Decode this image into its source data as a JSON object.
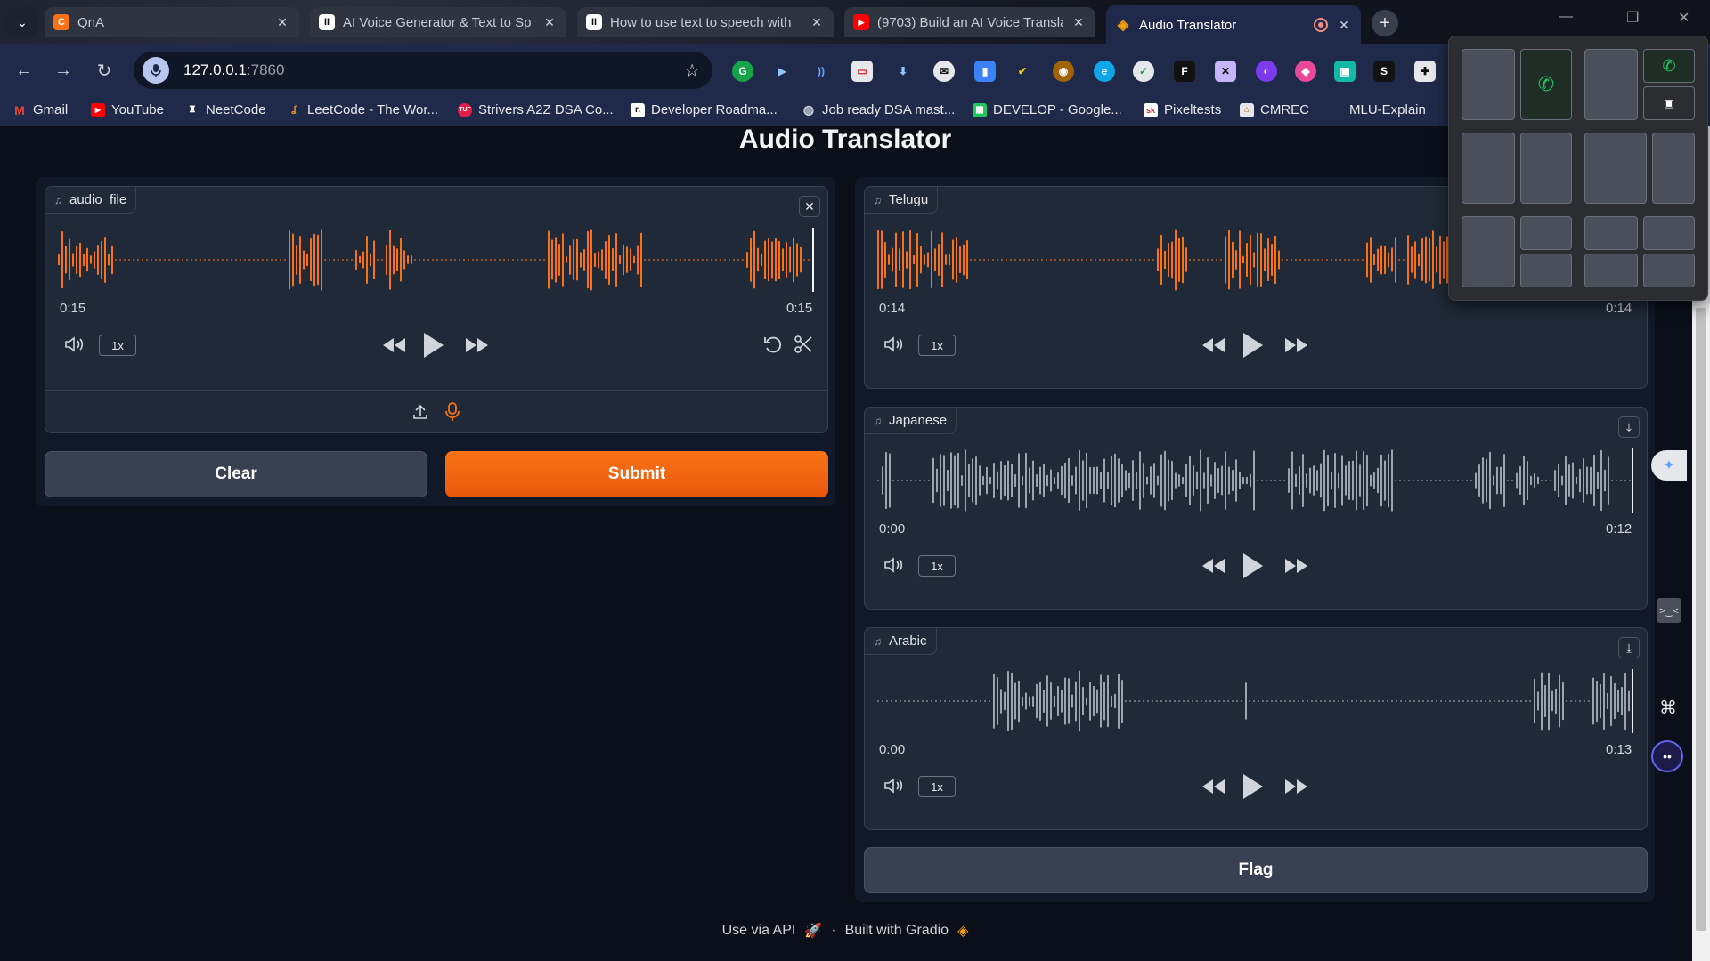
{
  "browser": {
    "tabs": [
      {
        "title": "QnA",
        "favicon_color": "#f97316",
        "favicon_glyph": "C"
      },
      {
        "title": "AI Voice Generator & Text to Sp",
        "favicon_color": "#ffffff",
        "favicon_glyph": "II"
      },
      {
        "title": "How to use text to speech with",
        "favicon_color": "#ffffff",
        "favicon_glyph": "II"
      },
      {
        "title": "(9703) Build an AI Voice Transla",
        "favicon_color": "#ff0000",
        "favicon_glyph": "▶"
      },
      {
        "title": "Audio Translator",
        "favicon_color": "#f59e0b",
        "favicon_glyph": "◈",
        "active": true
      }
    ],
    "url_host": "127.0.0.1",
    "url_port": ":7860",
    "bookmarks": [
      {
        "label": "Gmail",
        "icon": "gmail-icon",
        "color": "#ea4335"
      },
      {
        "label": "YouTube",
        "icon": "youtube-icon",
        "color": "#ff0000"
      },
      {
        "label": "NeetCode",
        "icon": "neetcode-icon",
        "color": "#ffffff"
      },
      {
        "label": "LeetCode - The Wor...",
        "icon": "leetcode-icon",
        "color": "#f89f1b"
      },
      {
        "label": "Strivers A2Z DSA Co...",
        "icon": "tuf-icon",
        "color": "#e11d48"
      },
      {
        "label": "Developer Roadma...",
        "icon": "roadmap-icon",
        "color": "#ffffff"
      },
      {
        "label": "Job ready DSA mast...",
        "icon": "globe-icon",
        "color": "#9ca3af"
      },
      {
        "label": "DEVELOP - Google...",
        "icon": "sheets-icon",
        "color": "#22c55e"
      },
      {
        "label": "Pixeltests",
        "icon": "pixeltests-icon",
        "color": "#dc2626"
      },
      {
        "label": "CMREC",
        "icon": "cmrec-icon",
        "color": "#a16207"
      },
      {
        "label": "MLU-Explain",
        "icon": "mlu-icon",
        "color": "#1f2a4a"
      }
    ]
  },
  "app": {
    "title": "Audio Translator",
    "input": {
      "label": "audio_file",
      "time_current": "0:15",
      "time_total": "0:15",
      "speed": "1x",
      "wave_color": "#f97316"
    },
    "outputs": [
      {
        "label": "Telugu",
        "time_current": "0:14",
        "time_total": "0:14",
        "speed": "1x",
        "wave_color": "#f97316"
      },
      {
        "label": "Japanese",
        "time_current": "0:00",
        "time_total": "0:12",
        "speed": "1x",
        "wave_color": "#9ca3af"
      },
      {
        "label": "Arabic",
        "time_current": "0:00",
        "time_total": "0:13",
        "speed": "1x",
        "wave_color": "#9ca3af"
      }
    ],
    "buttons": {
      "clear": "Clear",
      "submit": "Submit",
      "flag": "Flag"
    },
    "footer": {
      "api": "Use via API",
      "separator": "·",
      "built": "Built with Gradio"
    }
  }
}
